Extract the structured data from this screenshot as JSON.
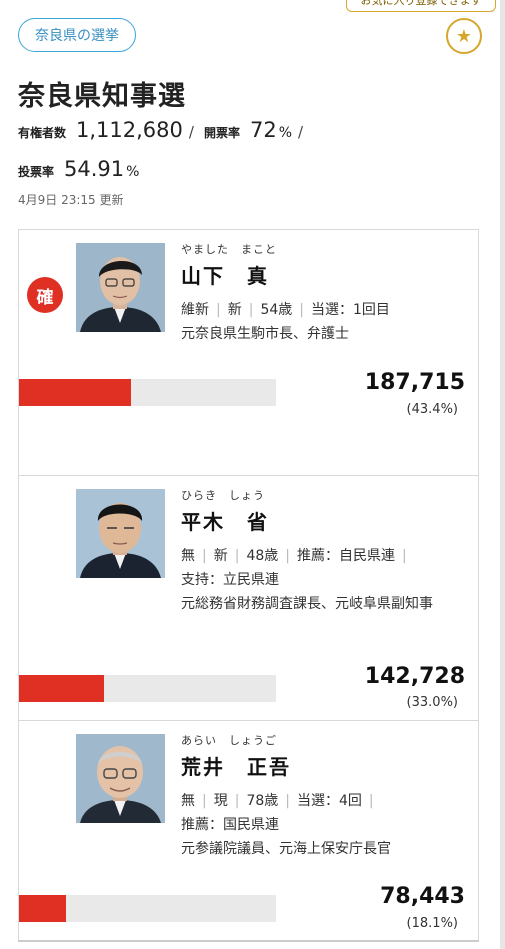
{
  "favorite": {
    "tooltip": "お気に入り登録できます",
    "icon": "star-icon",
    "color": "#d6a72a"
  },
  "breadcrumb": {
    "label": "奈良県の選挙"
  },
  "page": {
    "title": "奈良県知事選"
  },
  "stats": {
    "electorate_label": "有権者数",
    "electorate_value": "1,112,680",
    "counted_label": "開票率",
    "counted_value": "72",
    "counted_unit": "%",
    "turnout_label": "投票率",
    "turnout_value": "54.91",
    "turnout_unit": "%",
    "separator": "/"
  },
  "updated": "4月9日 23:15 更新",
  "candidates": [
    {
      "kana": "やました　まこと",
      "name": "山下　真",
      "badge": "確",
      "party": "維新",
      "status": "新",
      "age": "54歳",
      "tag": "当選：1回目",
      "extra": "",
      "career": "元奈良県生駒市長、弁護士",
      "votes": "187,715",
      "pct": "(43.4%)",
      "share": 0.434
    },
    {
      "kana": "ひらき　しょう",
      "name": "平木　省",
      "badge": "",
      "party": "無",
      "status": "新",
      "age": "48歳",
      "tag": "推薦：自民県連",
      "extra": "支持：立民県連",
      "career": "元総務省財務調査課長、元岐阜県副知事",
      "votes": "142,728",
      "pct": "(33.0%)",
      "share": 0.33
    },
    {
      "kana": "あらい　しょうご",
      "name": "荒井　正吾",
      "badge": "",
      "party": "無",
      "status": "現",
      "age": "78歳",
      "tag": "当選：4回",
      "extra": "推薦：国民県連",
      "career": "元参議院議員、元海上保安庁長官",
      "votes": "78,443",
      "pct": "(18.1%)",
      "share": 0.181
    }
  ],
  "colors": {
    "accent": "#e03023",
    "link": "#3a8fc2",
    "bar_bg": "#e9e9e9"
  }
}
